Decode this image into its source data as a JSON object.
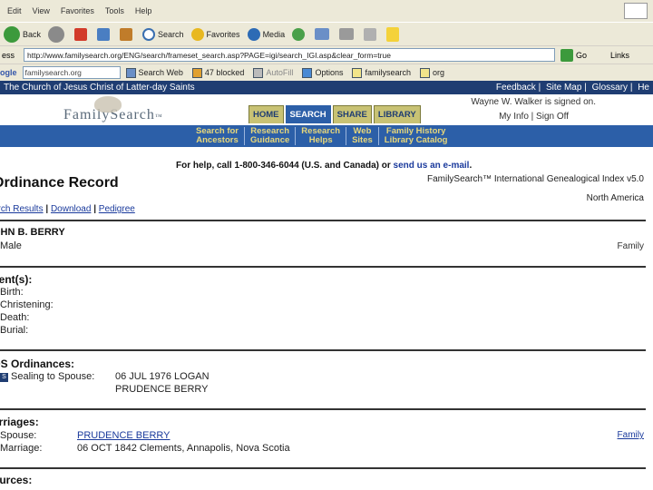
{
  "browser": {
    "menu": [
      "Edit",
      "View",
      "Favorites",
      "Tools",
      "Help"
    ],
    "toolbar": {
      "back": "Back",
      "search": "Search",
      "favorites": "Favorites",
      "media": "Media"
    },
    "address": {
      "label": "ess",
      "url": "http://www.familysearch.org/ENG/search/frameset_search.asp?PAGE=igi/search_IGI.asp&clear_form=true",
      "go": "Go",
      "links": "Links"
    },
    "google_bar": {
      "logo": "ogle",
      "search_value": "familysearch.org",
      "search_web": "Search Web",
      "blocked": "47 blocked",
      "autofill": "AutoFill",
      "options": "Options",
      "highlight1": "familysearch",
      "highlight2": "org"
    }
  },
  "site": {
    "church": "The Church of Jesus Christ of Latter-day Saints",
    "top_links": [
      "Feedback",
      "Site Map",
      "Glossary",
      "He"
    ],
    "logo": "FamilySearch",
    "logo_tm": "™",
    "tabs": [
      "HOME",
      "SEARCH",
      "SHARE",
      "LIBRARY"
    ],
    "signed_in": "Wayne W. Walker is signed on.",
    "my_info": "My Info",
    "sign_off": "Sign Off",
    "subnav": [
      {
        "line1": "Search for",
        "line2": "Ancestors"
      },
      {
        "line1": "Research",
        "line2": "Guidance"
      },
      {
        "line1": "Research",
        "line2": "Helps"
      },
      {
        "line1": "Web",
        "line2": "Sites"
      },
      {
        "line1": "Family History",
        "line2": "Library Catalog"
      }
    ]
  },
  "page": {
    "help_prefix": "For help, call 1-800-346-6044 (U.S. and Canada) or ",
    "help_link": "send us an e-mail",
    "help_suffix": ".",
    "index_name": "FamilySearch™ International Genealogical Index v5.0",
    "region": "North America",
    "title": "Ordinance Record",
    "crumbs": [
      "arch Results",
      "Download",
      "Pedigree"
    ],
    "crumb_sep": " | ",
    "person_name": "OHN B. BERRY",
    "sex": "Male",
    "family_link": "Family",
    "events_heading": "vent(s):",
    "events": [
      {
        "label": "Birth:"
      },
      {
        "label": "Christening:"
      },
      {
        "label": "Death:"
      },
      {
        "label": "Burial:"
      }
    ],
    "lds_heading": "DS Ordinances:",
    "sealing_badge": "S",
    "sealing_label": "Sealing to Spouse:",
    "sealing_value_1": "06 JUL 1976   LOGAN",
    "sealing_value_2": "PRUDENCE BERRY",
    "marriages_heading": "arriages:",
    "spouse_label": "Spouse:",
    "spouse_value": "PRUDENCE BERRY",
    "marriage_label": "Marriage:",
    "marriage_value": "06 OCT 1842   Clements, Annapolis, Nova Scotia",
    "marriage_family_link": "Family",
    "bottom_heading": "ources:"
  },
  "colors": {
    "header_navy": "#1f3d72",
    "nav_blue": "#2c5fa8",
    "link_blue": "#1a3a9c",
    "subnav_gold": "#e8d77a"
  }
}
